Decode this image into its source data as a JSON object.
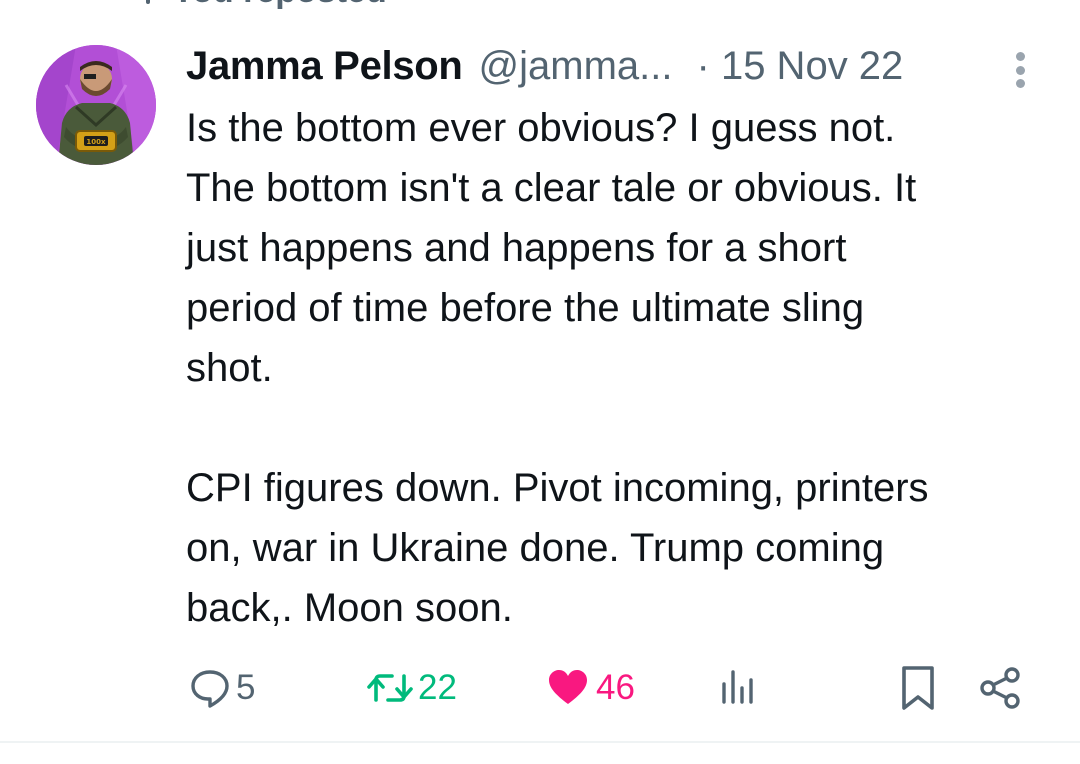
{
  "colors": {
    "text_primary": "#0f1419",
    "text_secondary": "#536471",
    "repost_green": "#00ba7c",
    "like_pink": "#f91880",
    "avatar_bg": "#b24fd6"
  },
  "repost_banner": {
    "label": "You reposted",
    "icon": "repost-icon"
  },
  "tweet": {
    "author_name": "Jamma Pelson",
    "handle": "@jamma...",
    "date": "· 15 Nov 22",
    "more_icon": "more-vertical-icon",
    "lines": [
      "Is the bottom ever obvious? I guess not.",
      "The bottom isn't a clear tale or obvious. It",
      "just happens and happens for a short",
      "period of time before the ultimate sling",
      "shot."
    ],
    "lines2": [
      "CPI figures down. Pivot incoming, printers",
      "on, war in Ukraine done. Trump coming",
      "back,. Moon soon."
    ]
  },
  "actions": {
    "reply": {
      "icon": "reply-icon",
      "count": "5"
    },
    "repost": {
      "icon": "repost-icon",
      "count": "22"
    },
    "like": {
      "icon": "heart-icon",
      "count": "46",
      "liked": true
    },
    "views": {
      "icon": "views-icon"
    },
    "bookmark": {
      "icon": "bookmark-icon"
    },
    "share": {
      "icon": "share-icon"
    }
  }
}
